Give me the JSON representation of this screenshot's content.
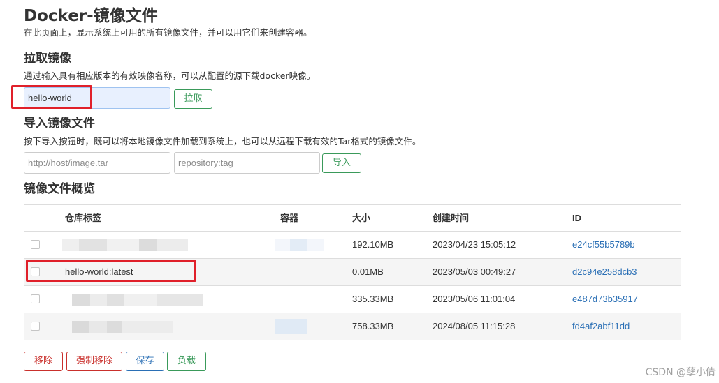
{
  "page": {
    "title": "Docker-镜像文件",
    "description": "在此页面上，显示系统上可用的所有镜像文件，并可以用它们来创建容器。"
  },
  "pull": {
    "heading": "拉取镜像",
    "description": "通过输入具有相应版本的有效映像名称，可以从配置的源下载docker映像。",
    "input_value": "hello-world",
    "button_label": "拉取"
  },
  "import": {
    "heading": "导入镜像文件",
    "description": "按下导入按钮时，既可以将本地镜像文件加载到系统上，也可以从远程下载有效的Tar格式的镜像文件。",
    "url_placeholder": "http://host/image.tar",
    "tag_placeholder": "repository:tag",
    "button_label": "导入"
  },
  "overview": {
    "heading": "镜像文件概览",
    "columns": {
      "tag": "仓库标签",
      "containers": "容器",
      "size": "大小",
      "created": "创建时间",
      "id": "ID"
    },
    "rows": [
      {
        "tag": "",
        "size": "192.10MB",
        "created": "2023/04/23 15:05:12",
        "id": "e24cf55b5789b",
        "checked": false
      },
      {
        "tag": "hello-world:latest",
        "size": "0.01MB",
        "created": "2023/05/03 00:49:27",
        "id": "d2c94e258dcb3",
        "checked": false
      },
      {
        "tag": "",
        "size": "335.33MB",
        "created": "2023/05/06 11:01:04",
        "id": "e487d73b35917",
        "checked": false
      },
      {
        "tag": "",
        "size": "758.33MB",
        "created": "2024/08/05 11:15:28",
        "id": "fd4af2abf11dd",
        "checked": false
      }
    ]
  },
  "actions": {
    "remove": "移除",
    "force_remove": "强制移除",
    "save": "保存",
    "load": "负载"
  },
  "watermark": "CSDN @孽小倩",
  "colors": {
    "highlight_box": "#e0202a",
    "link": "#2a6fb5",
    "success": "#3a9a5a",
    "danger": "#c9302c"
  }
}
